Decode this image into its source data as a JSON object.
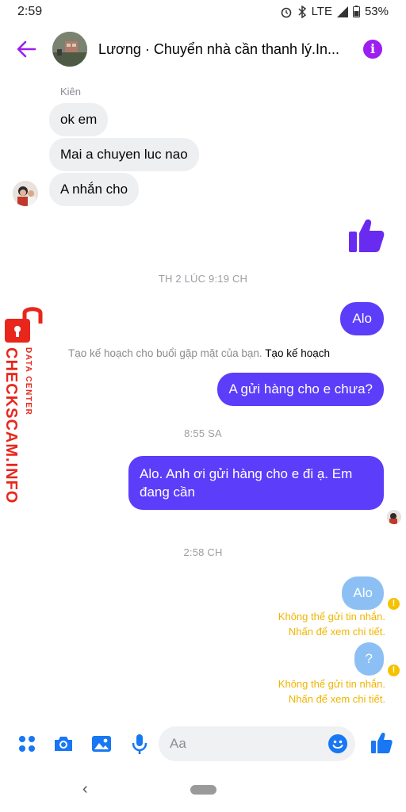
{
  "status_bar": {
    "time": "2:59",
    "network": "LTE",
    "battery": "53%"
  },
  "header": {
    "title": "Lương · Chuyển nhà cần thanh lý.In..."
  },
  "thread": {
    "sender_name": "Kiên",
    "incoming": [
      "ok em",
      "Mai a chuyen luc nao",
      "A nhắn cho"
    ],
    "timestamp_1": "TH 2 LÚC 9:19 CH",
    "outgoing_1": "Alo",
    "plan_prompt": "Tạo kế hoạch cho buổi gặp mặt của bạn.",
    "plan_link": "Tạo kế hoạch",
    "outgoing_2": "A gửi hàng cho e chưa?",
    "timestamp_2": "8:55 SA",
    "outgoing_3_line1": "Alo. Anh ơi gửi hàng cho e đi ạ. Em",
    "outgoing_3_line2": "đang cần",
    "timestamp_3": "2:58 CH",
    "failed_1": "Alo",
    "failed_2": "?",
    "error_line1": "Không thể gửi tin nhắn.",
    "error_line2": "Nhấn để xem chi tiết."
  },
  "composer": {
    "placeholder": "Aa"
  },
  "watermark": {
    "brand": "CHECKSCAM.INFO",
    "tag": "DATA CENTER"
  },
  "colors": {
    "accent": "#5b3dfa",
    "purple": "#9c1ef0",
    "messenger_blue": "#1877f2",
    "warning": "#f0b400"
  }
}
